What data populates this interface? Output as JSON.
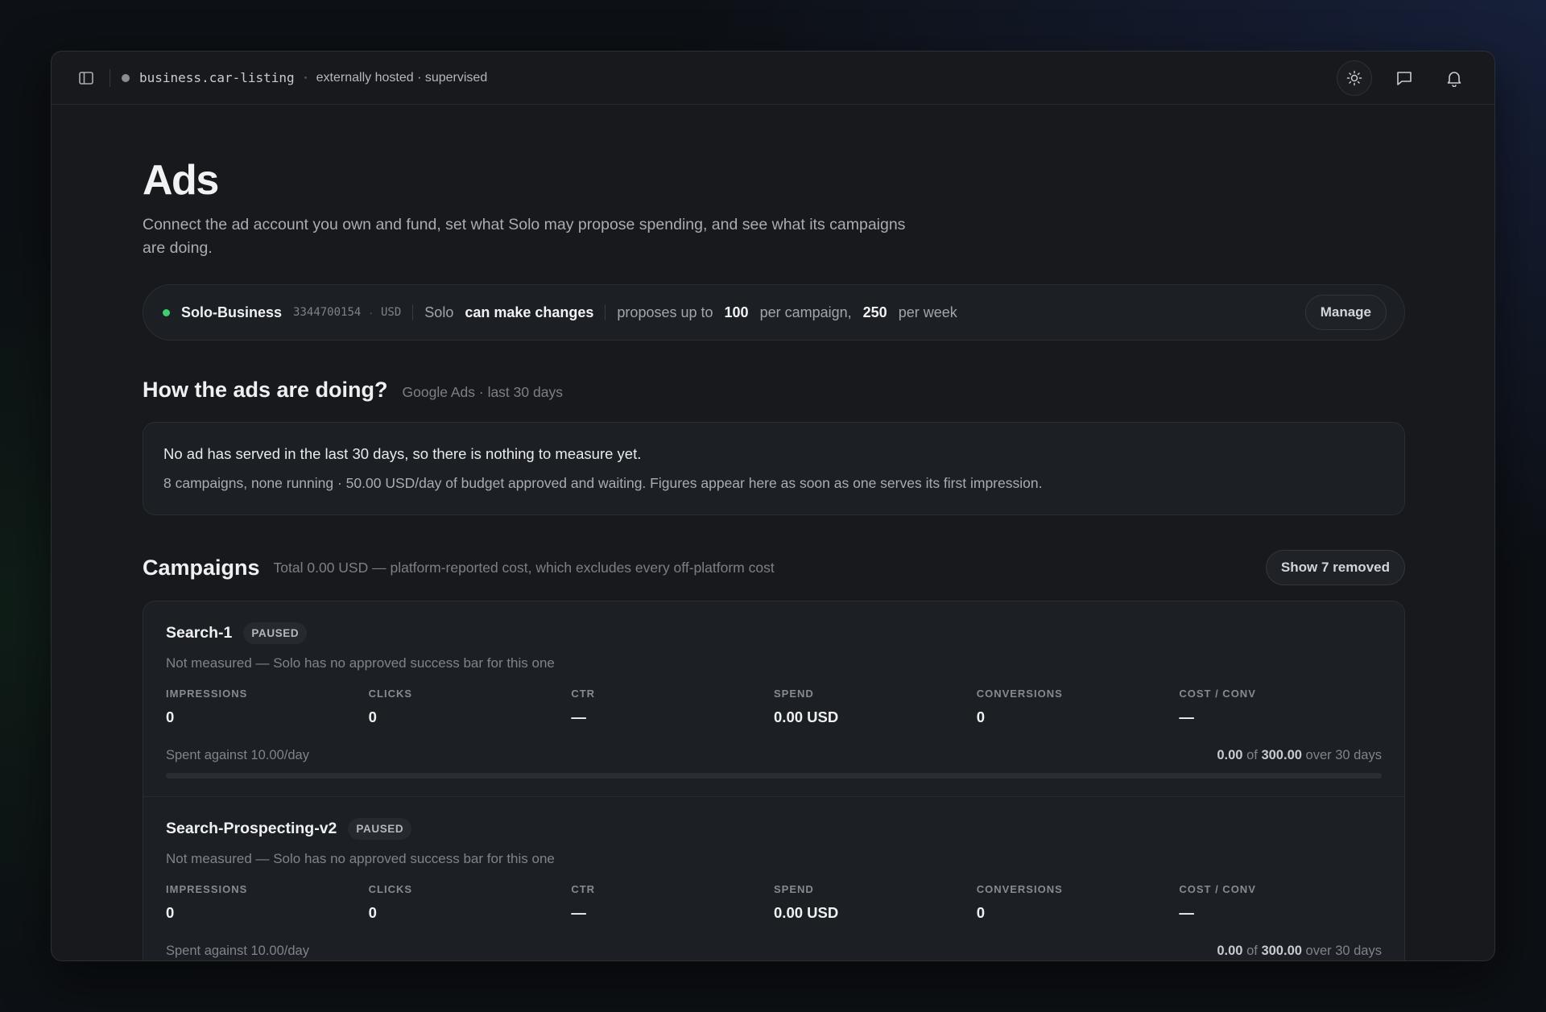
{
  "topbar": {
    "project": "business.car-listing",
    "hosting": "externally hosted · supervised"
  },
  "page": {
    "title": "Ads",
    "subtitle": "Connect the ad account you own and fund, set what Solo may propose spending, and see what its campaigns are doing."
  },
  "account": {
    "name": "Solo-Business",
    "id": "3344700154",
    "sep": "·",
    "currency": "USD",
    "actor": "Solo",
    "permission": "can make changes",
    "proposes_label": "proposes up to",
    "per_campaign_value": "100",
    "per_campaign_label": "per campaign,",
    "per_week_value": "250",
    "per_week_label": "per week",
    "manage_label": "Manage",
    "status_color": "#3ccf6e"
  },
  "performance": {
    "title": "How the ads are doing?",
    "meta": "Google Ads · last 30 days",
    "headline": "No ad has served in the last 30 days, so there is nothing to measure yet.",
    "detail": "8 campaigns, none running · 50.00 USD/day of budget approved and waiting. Figures appear here as soon as one serves its first impression."
  },
  "campaigns_section": {
    "title": "Campaigns",
    "meta": "Total 0.00 USD — platform-reported cost, which excludes every off-platform cost",
    "show_removed_label": "Show 7 removed"
  },
  "campaigns": [
    {
      "name": "Search-1",
      "status": "PAUSED",
      "note": "Not measured — Solo has no approved success bar for this one",
      "metrics": [
        {
          "label": "IMPRESSIONS",
          "value": "0"
        },
        {
          "label": "CLICKS",
          "value": "0"
        },
        {
          "label": "CTR",
          "value": "—"
        },
        {
          "label": "SPEND",
          "value": "0.00 USD"
        },
        {
          "label": "CONVERSIONS",
          "value": "0"
        },
        {
          "label": "COST / CONV",
          "value": "—"
        }
      ],
      "spent_against": "Spent against 10.00/day",
      "spent": "0.00",
      "of": "of",
      "budget": "300.00",
      "period": "over 30 days",
      "progress": 0
    },
    {
      "name": "Search-Prospecting-v2",
      "status": "PAUSED",
      "note": "Not measured — Solo has no approved success bar for this one",
      "metrics": [
        {
          "label": "IMPRESSIONS",
          "value": "0"
        },
        {
          "label": "CLICKS",
          "value": "0"
        },
        {
          "label": "CTR",
          "value": "—"
        },
        {
          "label": "SPEND",
          "value": "0.00 USD"
        },
        {
          "label": "CONVERSIONS",
          "value": "0"
        },
        {
          "label": "COST / CONV",
          "value": "—"
        }
      ],
      "spent_against": "Spent against 10.00/day",
      "spent": "0.00",
      "of": "of",
      "budget": "300.00",
      "period": "over 30 days",
      "progress": 0
    }
  ],
  "icons": {
    "sidebar": "sidebar-toggle-icon",
    "theme": "sun-icon",
    "chat": "chat-icon",
    "notifications": "bell-icon"
  }
}
